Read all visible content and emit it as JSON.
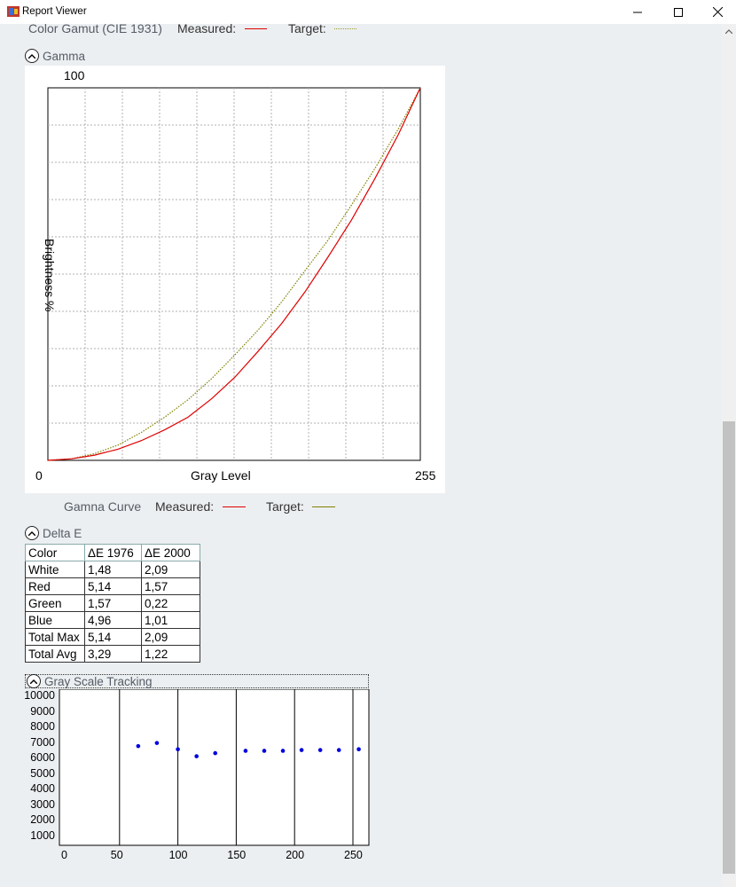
{
  "window": {
    "title": "Report Viewer",
    "minimize_icon": "minimize-icon",
    "maximize_icon": "maximize-icon",
    "close_icon": "close-icon"
  },
  "color_gamut_legend": {
    "title": "Color Gamut (CIE 1931)",
    "measured_label": "Measured:",
    "target_label": "Target:",
    "measured_color": "#e00000",
    "target_color": "#9a9a2a"
  },
  "gamma": {
    "section_label": "Gamma",
    "toggle_icon": "chevron-up-icon",
    "y_max_label": "100",
    "x_min_label": "0",
    "x_max_label": "255",
    "x_axis_label": "Gray Level",
    "y_axis_label": "Brightness %",
    "legend_title": "Gamna Curve",
    "measured_label": "Measured:",
    "target_label": "Target:",
    "measured_color": "#e00000",
    "target_color": "#808000"
  },
  "delta_e": {
    "section_label": "Delta E",
    "toggle_icon": "chevron-up-icon",
    "headers": [
      "Color",
      "ΔE 1976",
      "ΔE 2000"
    ],
    "rows": [
      [
        "White",
        "1,48",
        "2,09"
      ],
      [
        "Red",
        "5,14",
        "1,57"
      ],
      [
        "Green",
        "1,57",
        "0,22"
      ],
      [
        "Blue",
        "4,96",
        "1,01"
      ],
      [
        "Total Max",
        "5,14",
        "2,09"
      ],
      [
        "Total Avg",
        "3,29",
        "1,22"
      ]
    ]
  },
  "gray_scale": {
    "section_label": "Gray Scale Tracking",
    "toggle_icon": "chevron-up-icon",
    "y_labels": [
      "10000",
      "9000",
      "8000",
      "7000",
      "6000",
      "5000",
      "4000",
      "3000",
      "2000",
      "1000"
    ],
    "x_labels": [
      "0",
      "50",
      "100",
      "150",
      "200",
      "250"
    ],
    "point_color": "#0000dd"
  },
  "chart_data": [
    {
      "type": "line",
      "x": [
        0,
        16,
        32,
        48,
        64,
        80,
        96,
        112,
        128,
        144,
        160,
        176,
        192,
        208,
        224,
        240,
        255
      ],
      "series": [
        {
          "name": "Measured",
          "values": [
            0,
            0.4,
            1.4,
            3.0,
            5.3,
            8.2,
            11.6,
            16.5,
            22.3,
            29.3,
            36.7,
            45.2,
            54.7,
            64.6,
            75.7,
            87.5,
            100
          ]
        },
        {
          "name": "Target",
          "values": [
            0,
            0.4,
            1.8,
            4.1,
            7.5,
            11.6,
            16.3,
            21.9,
            28.3,
            35.0,
            42.5,
            50.9,
            59.2,
            68.6,
            78.4,
            89.0,
            100
          ]
        }
      ],
      "xlabel": "Gray Level",
      "ylabel": "Brightness %",
      "xlim": [
        0,
        255
      ],
      "ylim": [
        0,
        100
      ],
      "grid": true
    },
    {
      "type": "scatter",
      "x": [
        66,
        82,
        100,
        116,
        132,
        158,
        174,
        190,
        206,
        222,
        238,
        255
      ],
      "y": [
        6800,
        7000,
        6600,
        6150,
        6350,
        6500,
        6500,
        6500,
        6550,
        6550,
        6550,
        6600
      ],
      "xlim": [
        0,
        260
      ],
      "ylim": [
        0,
        10000
      ],
      "grid": true
    }
  ]
}
